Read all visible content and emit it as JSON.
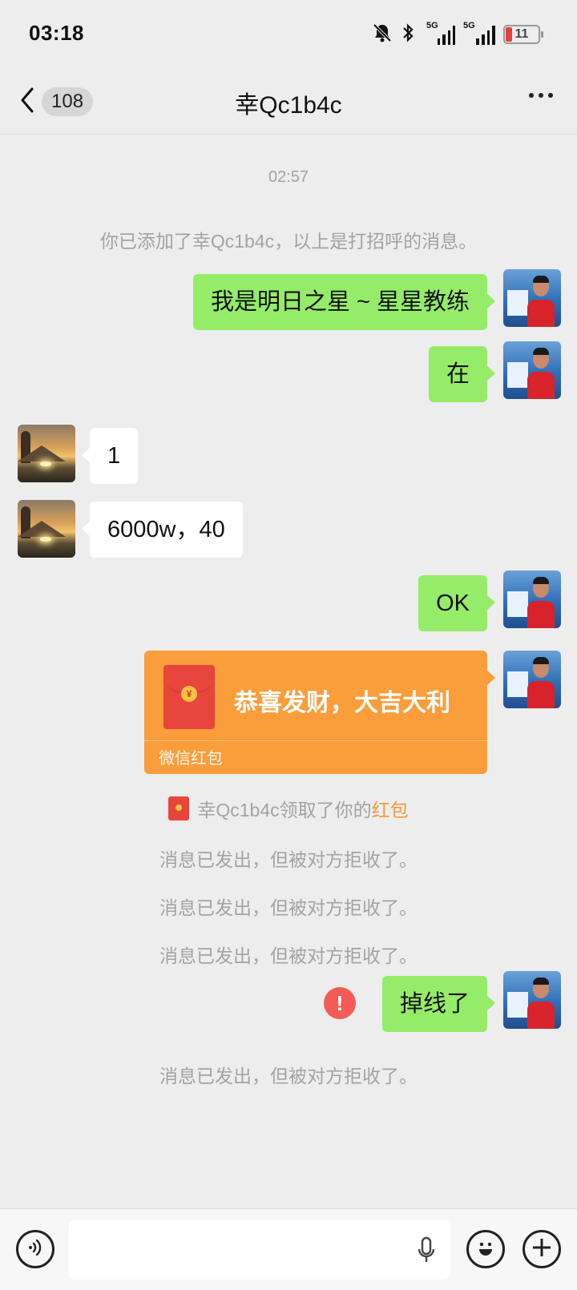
{
  "status_bar": {
    "time": "03:18",
    "signal1_label": "5G",
    "signal2_label": "5G",
    "battery_level": "11"
  },
  "nav": {
    "back_count": "108",
    "title": "幸Qc1b4c"
  },
  "chat": {
    "timestamp": "02:57",
    "added_notice": "你已添加了幸Qc1b4c，以上是打招呼的消息。",
    "messages": [
      {
        "from": "me",
        "text": "我是明日之星 ~ 星星教练"
      },
      {
        "from": "me",
        "text": "在"
      },
      {
        "from": "other",
        "text": "1"
      },
      {
        "from": "other",
        "text": "6000w，40"
      },
      {
        "from": "me",
        "text": "OK"
      }
    ],
    "red_packet": {
      "title": "恭喜发财，大吉大利",
      "label": "微信红包"
    },
    "red_packet_notice": {
      "prefix": "幸Qc1b4c领取了你的",
      "link": "红包"
    },
    "rejected_notice": "消息已发出，但被对方拒收了。",
    "failed_message": "掉线了",
    "failed_icon": "!"
  },
  "colors": {
    "my_bubble": "#95ec69",
    "red_packet": "#fa9d3b",
    "error": "#f25c54"
  }
}
